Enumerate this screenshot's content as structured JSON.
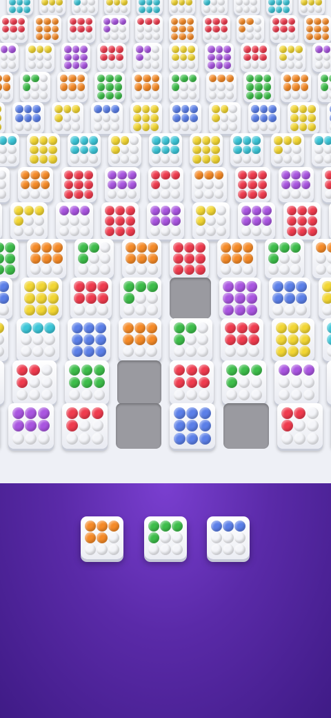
{
  "colors": {
    "cyan": "#3cc6d8",
    "yellow": "#f2d633",
    "red": "#ef3b4e",
    "orange": "#f58a27",
    "purple": "#a955e0",
    "green": "#3dbd4a",
    "blue": "#5b7fe8",
    "white": "#f4f5f9"
  },
  "board": {
    "rows": [
      [
        "cyan",
        "yellow",
        "cyan",
        "yellow",
        "cyan",
        "yellow",
        "cyan",
        "yellow",
        "cyan",
        "yellow"
      ],
      [
        "red",
        "orange",
        "red",
        "purple",
        "red",
        "orange",
        "red",
        "orange",
        "red",
        "orange"
      ],
      [
        "purple",
        "yellow",
        "purple",
        "red",
        "purple",
        "yellow",
        "purple",
        "red",
        "yellow",
        "purple"
      ],
      [
        "orange",
        "green",
        "orange",
        "green",
        "orange",
        "green",
        "orange",
        "green",
        "orange",
        "green"
      ],
      [
        "yellow",
        "blue",
        "yellow",
        "blue",
        "yellow",
        "blue",
        "yellow",
        "blue",
        "yellow",
        "blue"
      ],
      [
        "cyan",
        "yellow",
        "cyan",
        "yellow",
        "cyan",
        "yellow",
        "cyan",
        "yellow",
        "cyan"
      ],
      [
        "red",
        "orange",
        "red",
        "purple",
        "red",
        "orange",
        "red",
        "purple",
        "red"
      ],
      [
        "purple",
        "yellow",
        "purple",
        "red",
        "purple",
        "yellow",
        "purple",
        "red",
        "purple"
      ],
      [
        "green",
        "orange",
        "green",
        "orange",
        "red",
        "orange",
        "green",
        "orange"
      ],
      [
        "blue",
        "yellow",
        "red",
        "green",
        "empty",
        "purple",
        "blue",
        "yellow"
      ],
      [
        "yellow",
        "cyan",
        "blue",
        "orange",
        "green",
        "red",
        "yellow",
        "cyan"
      ],
      [
        "orange",
        "red",
        "green",
        "empty",
        "red",
        "green",
        "purple",
        "red"
      ],
      [
        "yellow",
        "purple",
        "red",
        "empty",
        "blue",
        "empty",
        "red",
        "purple"
      ]
    ]
  },
  "tray": {
    "pieces": [
      {
        "color": "orange"
      },
      {
        "color": "green"
      },
      {
        "color": "blue"
      }
    ]
  }
}
